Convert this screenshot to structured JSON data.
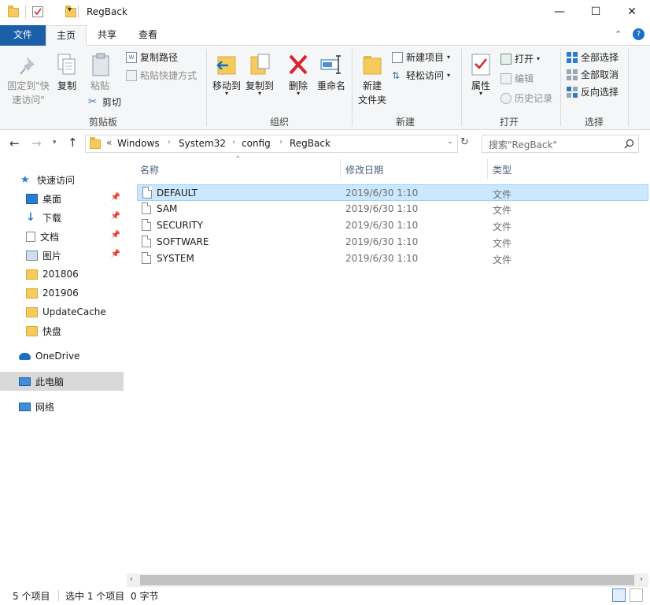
{
  "window": {
    "title": "RegBack",
    "controls": [
      "—",
      "☐",
      "✕"
    ]
  },
  "ribbon_tabs": [
    {
      "label": "文件"
    },
    {
      "label": "主页"
    },
    {
      "label": "共享"
    },
    {
      "label": "查看"
    }
  ],
  "ribbon": {
    "clipboard": {
      "pin_line1": "固定到\"快",
      "pin_line2": "速访问\"",
      "copy": "复制",
      "paste": "粘贴",
      "copy_path": "复制路径",
      "paste_shortcut": "粘贴快捷方式",
      "cut": "剪切",
      "group": "剪贴板"
    },
    "organize": {
      "move_to": "移动到",
      "copy_to": "复制到",
      "delete": "删除",
      "rename": "重命名",
      "group": "组织"
    },
    "new": {
      "new_folder_line1": "新建",
      "new_folder_line2": "文件夹",
      "new_item": "新建项目",
      "easy_access": "轻松访问",
      "group": "新建"
    },
    "open": {
      "properties": "属性",
      "open": "打开",
      "edit": "编辑",
      "history": "历史记录",
      "group": "打开"
    },
    "select": {
      "select_all": "全部选择",
      "select_none": "全部取消",
      "invert": "反向选择",
      "group": "选择"
    }
  },
  "address": {
    "prefix": "«",
    "crumbs": [
      "Windows",
      "System32",
      "config",
      "RegBack"
    ],
    "search_placeholder": "搜索\"RegBack\""
  },
  "nav": {
    "quick_access": "快速访问",
    "items": [
      {
        "label": "桌面",
        "icon": "desktop-icon",
        "pinned": true
      },
      {
        "label": "下载",
        "icon": "download-icon",
        "pinned": true
      },
      {
        "label": "文档",
        "icon": "documents-icon",
        "pinned": true
      },
      {
        "label": "图片",
        "icon": "pictures-icon",
        "pinned": true
      },
      {
        "label": "201806",
        "icon": "folder-icon",
        "pinned": false
      },
      {
        "label": "201906",
        "icon": "folder-icon",
        "pinned": false
      },
      {
        "label": "UpdateCache",
        "icon": "folder-icon",
        "pinned": false
      },
      {
        "label": "快盘",
        "icon": "folder-icon",
        "pinned": false
      }
    ],
    "onedrive": "OneDrive",
    "this_pc": "此电脑",
    "network": "网络"
  },
  "columns": {
    "name": "名称",
    "date": "修改日期",
    "type": "类型"
  },
  "files": [
    {
      "name": "DEFAULT",
      "date": "2019/6/30 1:10",
      "type": "文件",
      "selected": true
    },
    {
      "name": "SAM",
      "date": "2019/6/30 1:10",
      "type": "文件",
      "selected": false
    },
    {
      "name": "SECURITY",
      "date": "2019/6/30 1:10",
      "type": "文件",
      "selected": false
    },
    {
      "name": "SOFTWARE",
      "date": "2019/6/30 1:10",
      "type": "文件",
      "selected": false
    },
    {
      "name": "SYSTEM",
      "date": "2019/6/30 1:10",
      "type": "文件",
      "selected": false
    }
  ],
  "status": {
    "count": "5 个项目",
    "selected": "选中 1 个项目",
    "size": "0 字节"
  },
  "colors": {
    "file_tab": "#1a5fa8",
    "selection_bg": "#cce8ff",
    "folder": "#f4cb5c",
    "delete_red": "#d9232d"
  }
}
